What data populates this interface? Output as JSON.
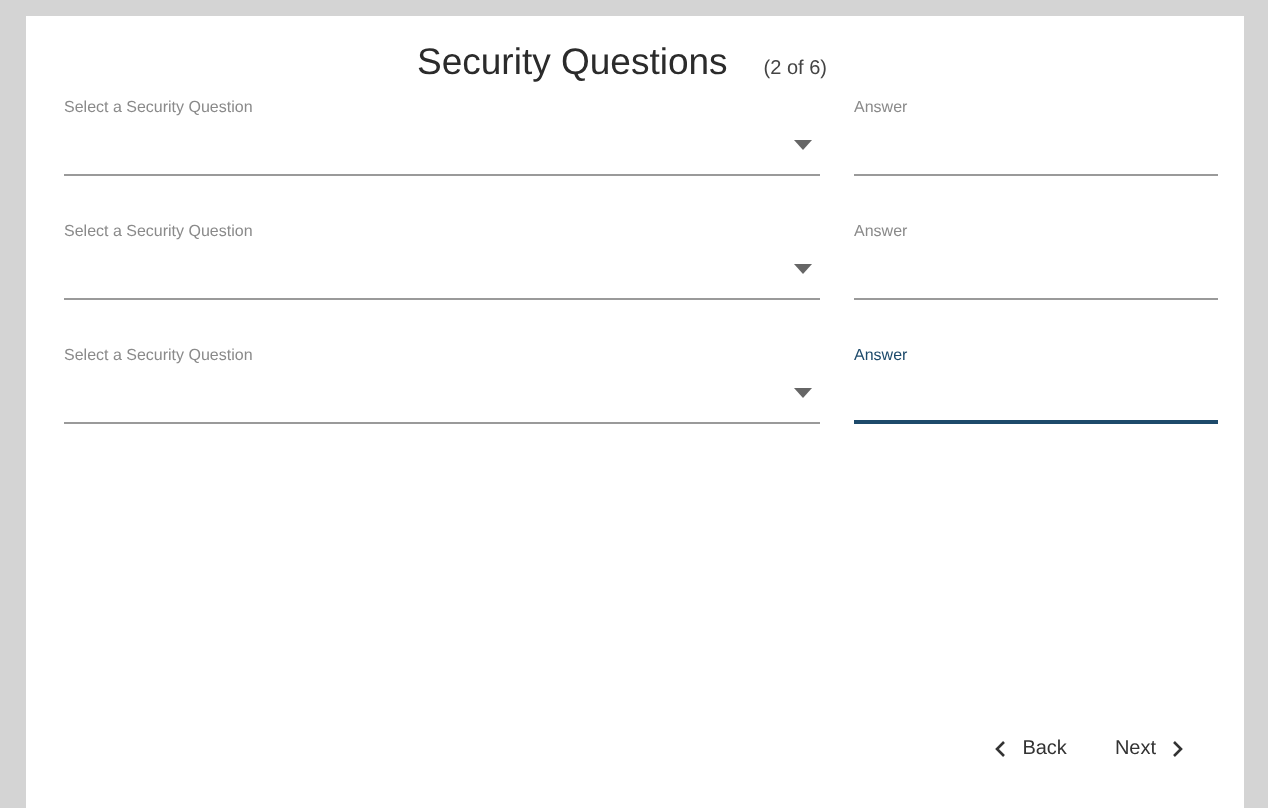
{
  "title": "Security Questions",
  "step": "(2 of 6)",
  "rows": [
    {
      "question": {
        "label": "Select a Security Question"
      },
      "answer": {
        "label": "Answer",
        "focused": false
      }
    },
    {
      "question": {
        "label": "Select a Security Question"
      },
      "answer": {
        "label": "Answer",
        "focused": false
      }
    },
    {
      "question": {
        "label": "Select a Security Question"
      },
      "answer": {
        "label": "Answer",
        "focused": true
      }
    }
  ],
  "buttons": [
    {
      "kind": "back",
      "label": "Back"
    },
    {
      "kind": "next",
      "label": "Next"
    }
  ]
}
